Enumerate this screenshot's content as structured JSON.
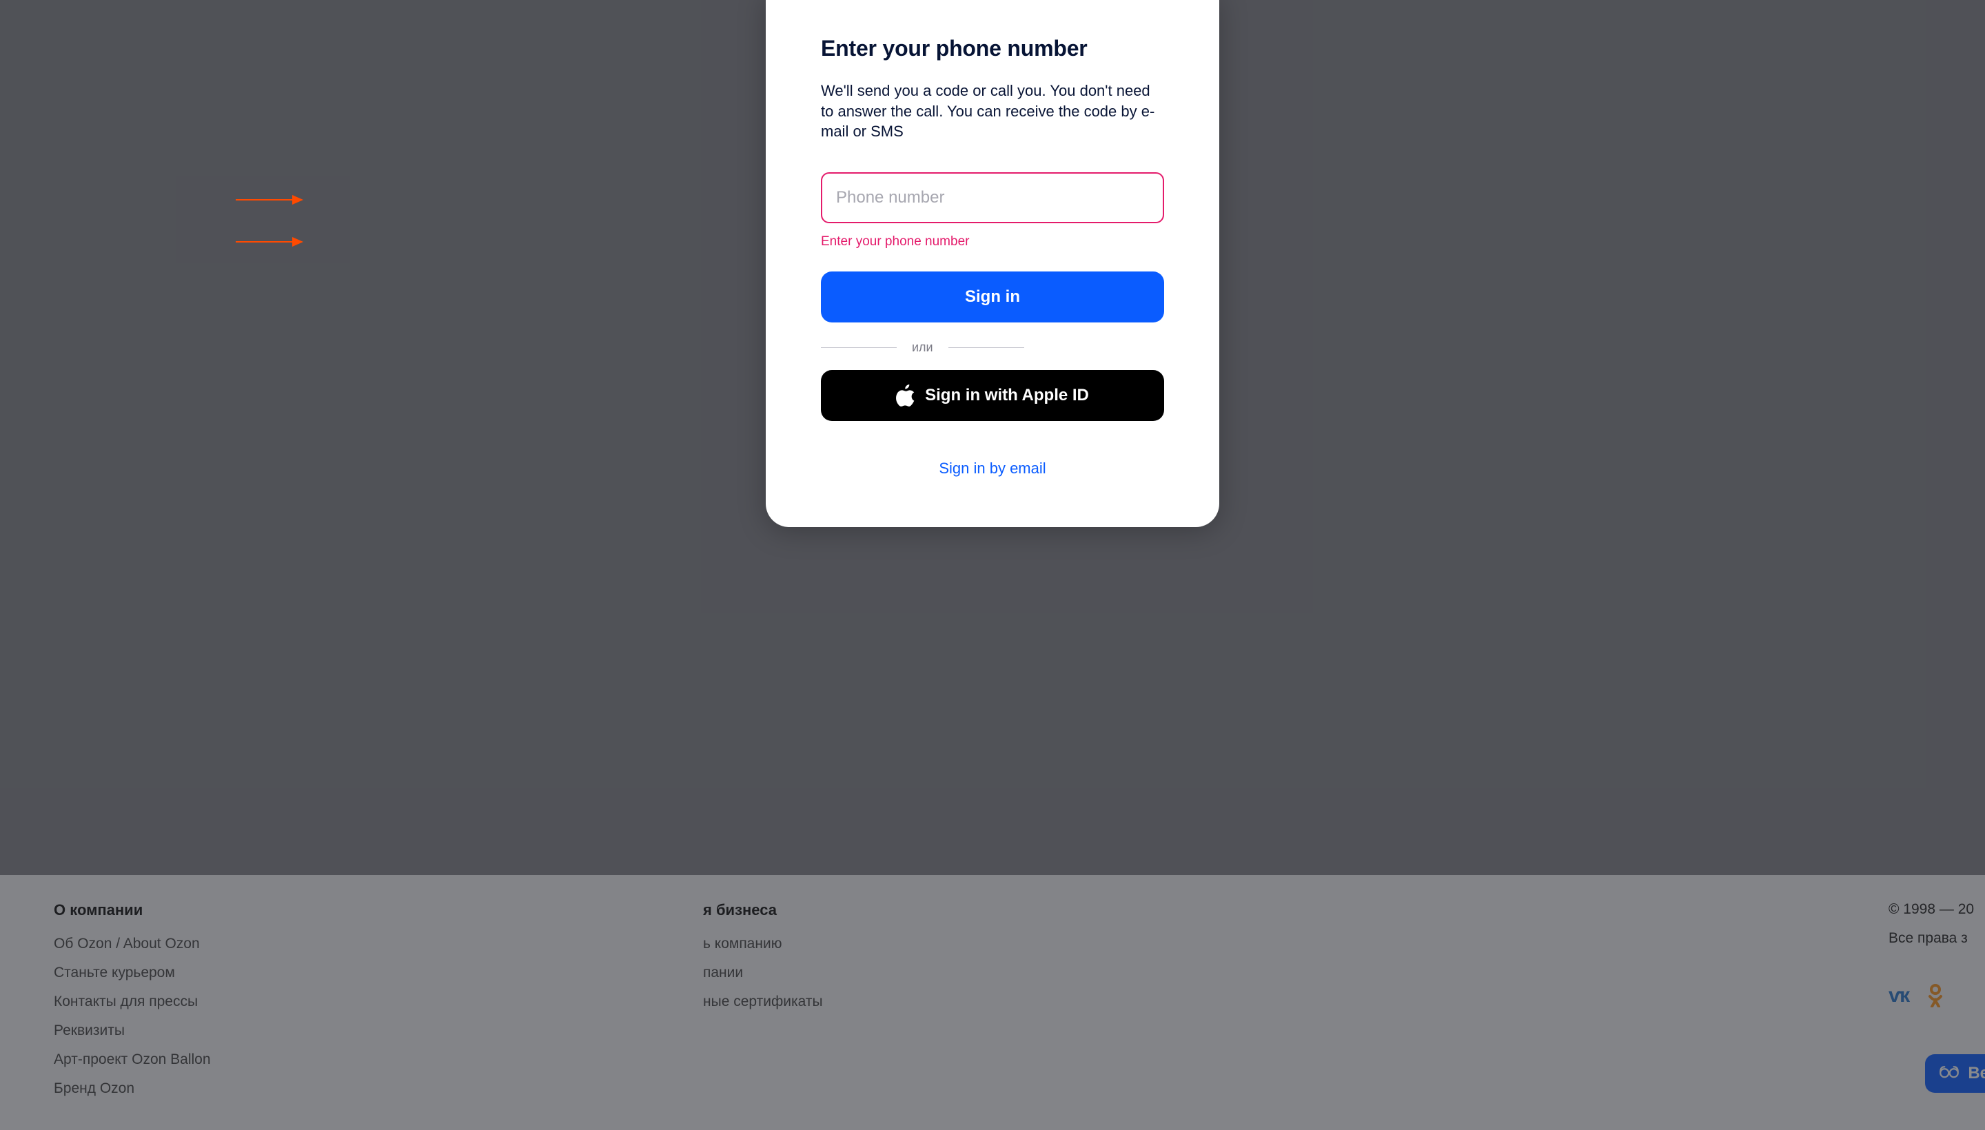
{
  "modal": {
    "title": "Enter your phone number",
    "description": "We'll send you a code or call you. You don't need to answer the call. You can receive the code by e-mail or SMS",
    "phone": {
      "placeholder": "Phone number",
      "value": ""
    },
    "error": "Enter your phone number",
    "signin_label": "Sign in",
    "divider_word": "или",
    "apple_label": "Sign in with Apple ID",
    "email_link_label": "Sign in by email"
  },
  "footer": {
    "company": {
      "heading": "О компании",
      "items": [
        "Об Ozon / About Ozon",
        "Станьте курьером",
        "Контакты для прессы",
        "Реквизиты",
        "Арт-проект Ozon Ballon",
        "Бренд Ozon"
      ]
    },
    "business": {
      "heading_suffix": "я бизнеса",
      "items": [
        "ь компанию",
        "пании",
        "ные сертификаты"
      ]
    },
    "right": {
      "copyright": "© 1998 — 20",
      "rights": "Все права з"
    },
    "vers_label": "Верс"
  },
  "colors": {
    "accent": "#0a5cff",
    "error": "#e41b6b",
    "arrow": "#ff4a00",
    "black": "#000000"
  }
}
